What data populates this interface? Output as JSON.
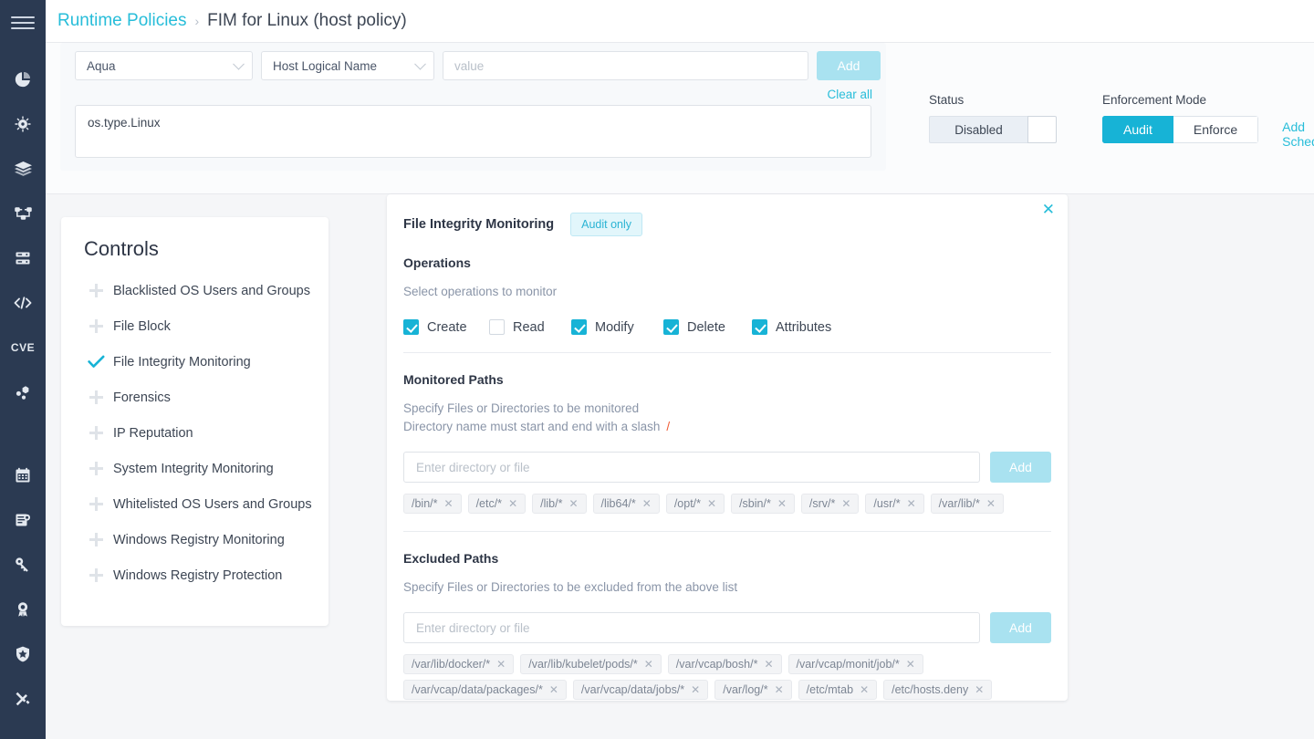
{
  "rail": {
    "menu_icon": "hamburger-menu-icon",
    "items": [
      {
        "icon": "pie-chart-icon",
        "name": "risk-explorer"
      },
      {
        "icon": "bug-shield-icon",
        "name": "vulnerabilities"
      },
      {
        "icon": "layers-icon",
        "name": "images"
      },
      {
        "icon": "workflow-icon",
        "name": "workloads"
      },
      {
        "icon": "server-stack-icon",
        "name": "infrastructure"
      },
      {
        "icon": "code-brackets-icon",
        "name": "code-repositories"
      },
      {
        "icon": "cve-text-icon",
        "name": "cve-search",
        "text": "CVE"
      },
      {
        "icon": "nodes-icon",
        "name": "supply-chain"
      },
      {
        "icon": "calendar-icon",
        "name": "reports"
      },
      {
        "icon": "certificate-doc-icon",
        "name": "compliance"
      },
      {
        "icon": "key-icon",
        "name": "secrets"
      },
      {
        "icon": "award-ribbon-icon",
        "name": "assurance"
      },
      {
        "icon": "shield-star-icon",
        "name": "policies"
      },
      {
        "icon": "tools-icon",
        "name": "administration"
      }
    ]
  },
  "breadcrumb": {
    "root": "Runtime Policies",
    "separator": "›",
    "current": "FIM for Linux (host policy)"
  },
  "filters": {
    "scope_select": "Aqua",
    "attribute_select": "Host Logical Name",
    "value_placeholder": "value",
    "value": "",
    "add_label": "Add",
    "clear_all_label": "Clear all",
    "scope_expression": "os.type.Linux"
  },
  "status": {
    "label": "Status",
    "value": "Disabled"
  },
  "enforcement": {
    "label": "Enforcement Mode",
    "options": [
      "Audit",
      "Enforce"
    ],
    "selected": "Audit"
  },
  "scheduler": {
    "add_label": "Add Scheduler"
  },
  "controls": {
    "title": "Controls",
    "items": [
      {
        "label": "Blacklisted OS Users and Groups",
        "enabled": false
      },
      {
        "label": "File Block",
        "enabled": false
      },
      {
        "label": "File Integrity Monitoring",
        "enabled": true
      },
      {
        "label": "Forensics",
        "enabled": false
      },
      {
        "label": "IP Reputation",
        "enabled": false
      },
      {
        "label": "System Integrity Monitoring",
        "enabled": false
      },
      {
        "label": "Whitelisted OS Users and Groups",
        "enabled": false
      },
      {
        "label": "Windows Registry Monitoring",
        "enabled": false
      },
      {
        "label": "Windows Registry Protection",
        "enabled": false
      }
    ]
  },
  "fim": {
    "title": "File Integrity Monitoring",
    "badge": "Audit only",
    "close_label": "✕",
    "operations": {
      "title": "Operations",
      "hint": "Select operations to monitor",
      "items": [
        {
          "label": "Create",
          "checked": true
        },
        {
          "label": "Read",
          "checked": false
        },
        {
          "label": "Modify",
          "checked": true
        },
        {
          "label": "Delete",
          "checked": true
        },
        {
          "label": "Attributes",
          "checked": true
        }
      ]
    },
    "monitored": {
      "title": "Monitored Paths",
      "hint_line1": "Specify Files or Directories to be monitored",
      "hint_line2": "Directory name must start and end with a slash",
      "required_mark": "/",
      "input_placeholder": "Enter directory or file",
      "input_value": "",
      "add_label": "Add",
      "tags": [
        "/bin/*",
        "/etc/*",
        "/lib/*",
        "/lib64/*",
        "/opt/*",
        "/sbin/*",
        "/srv/*",
        "/usr/*",
        "/var/lib/*"
      ]
    },
    "excluded": {
      "title": "Excluded Paths",
      "hint": "Specify Files or Directories to be excluded from the above list",
      "input_placeholder": "Enter directory or file",
      "input_value": "",
      "add_label": "Add",
      "tags": [
        "/var/lib/docker/*",
        "/var/lib/kubelet/pods/*",
        "/var/vcap/bosh/*",
        "/var/vcap/monit/job/*",
        "/var/vcap/data/packages/*",
        "/var/vcap/data/jobs/*",
        "/var/log/*",
        "/etc/mtab",
        "/etc/hosts.deny"
      ]
    }
  },
  "colors": {
    "accent": "#27bdd9",
    "accent_solid": "#17b3d6",
    "accent_pale": "#a9e2f0",
    "rail_bg": "#2b3a52",
    "required": "#f15a33"
  }
}
